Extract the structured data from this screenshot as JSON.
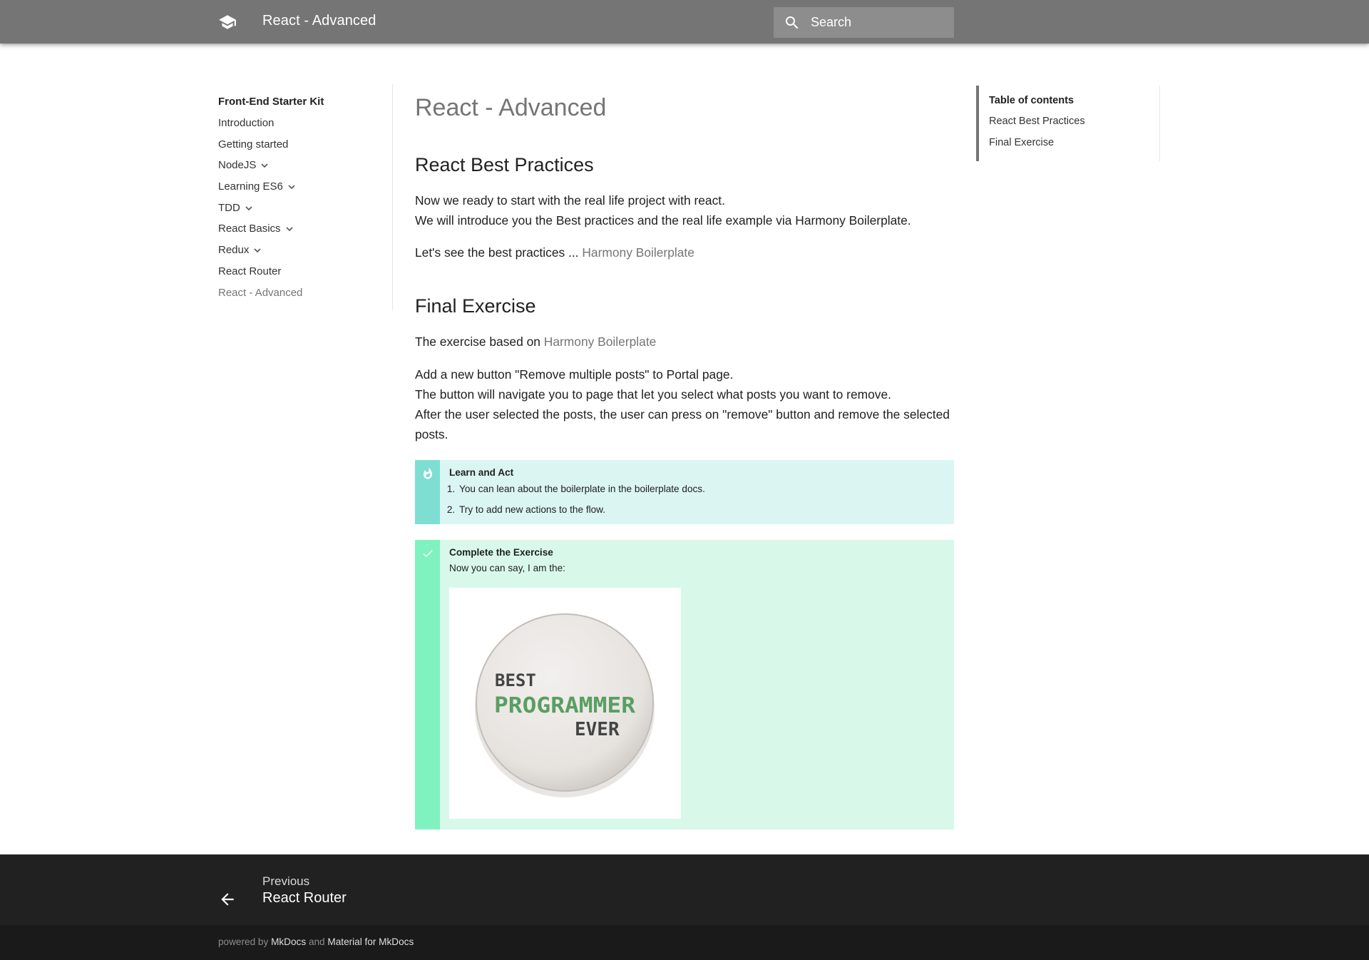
{
  "header": {
    "logo_icon": "school-icon",
    "title": "React - Advanced",
    "search": {
      "placeholder": "Search",
      "icon": "search-icon"
    }
  },
  "nav": {
    "title": "Front-End Starter Kit",
    "items": [
      {
        "label": "Introduction",
        "expandable": false,
        "active": false
      },
      {
        "label": "Getting started",
        "expandable": false,
        "active": false
      },
      {
        "label": "NodeJS",
        "expandable": true,
        "active": false
      },
      {
        "label": "Learning ES6",
        "expandable": true,
        "active": false
      },
      {
        "label": "TDD",
        "expandable": true,
        "active": false
      },
      {
        "label": "React Basics",
        "expandable": true,
        "active": false
      },
      {
        "label": "Redux",
        "expandable": true,
        "active": false
      },
      {
        "label": "React Router",
        "expandable": false,
        "active": false
      },
      {
        "label": "React - Advanced",
        "expandable": false,
        "active": true
      }
    ]
  },
  "content": {
    "page_title": "React - Advanced",
    "sections": {
      "best_practices": {
        "heading": "React Best Practices",
        "para1_line1": "Now we ready to start with the real life project with react.",
        "para1_line2": "We will introduce you the Best practices and the real life example via Harmony Boilerplate.",
        "para2_text": "Let's see the best practices ... ",
        "para2_link": "Harmony Boilerplate"
      },
      "final_exercise": {
        "heading": "Final Exercise",
        "para1_text": "The exercise based on ",
        "para1_link": "Harmony Boilerplate",
        "para2_line1": "Add a new button \"Remove multiple posts\" to Portal page.",
        "para2_line2": "The button will navigate you to page that let you select what posts you want to remove.",
        "para2_line3": "After the user selected the posts, the user can press on \"remove\" button and remove the selected posts."
      }
    },
    "tip": {
      "icon": "fire-icon",
      "title": "Learn and Act",
      "items": [
        "You can lean about the boilerplate in the boilerplate docs.",
        "Try to add new actions to the flow."
      ]
    },
    "success": {
      "icon": "check-icon",
      "title": "Complete the Exercise",
      "text": "Now you can say, I am the:",
      "badge": {
        "line1": "BEST",
        "line2": "PROGRAMMER",
        "line3": "EVER"
      }
    }
  },
  "toc": {
    "title": "Table of contents",
    "items": [
      "React Best Practices",
      "Final Exercise"
    ]
  },
  "footer": {
    "prev": {
      "direction": "Previous",
      "title": "React Router",
      "icon": "arrow-left-icon"
    },
    "powered_by": "powered by",
    "mkdocs": "MkDocs",
    "and": "and",
    "material": "Material for MkDocs"
  },
  "colors": {
    "primary": "#757575",
    "tip_bar": "#7fded2",
    "tip_bg": "#daf5f2",
    "success_bar": "#7ff2bf",
    "success_bg": "#d8f9ea",
    "footer": "#212121",
    "badge_green": "#5a9e62"
  }
}
